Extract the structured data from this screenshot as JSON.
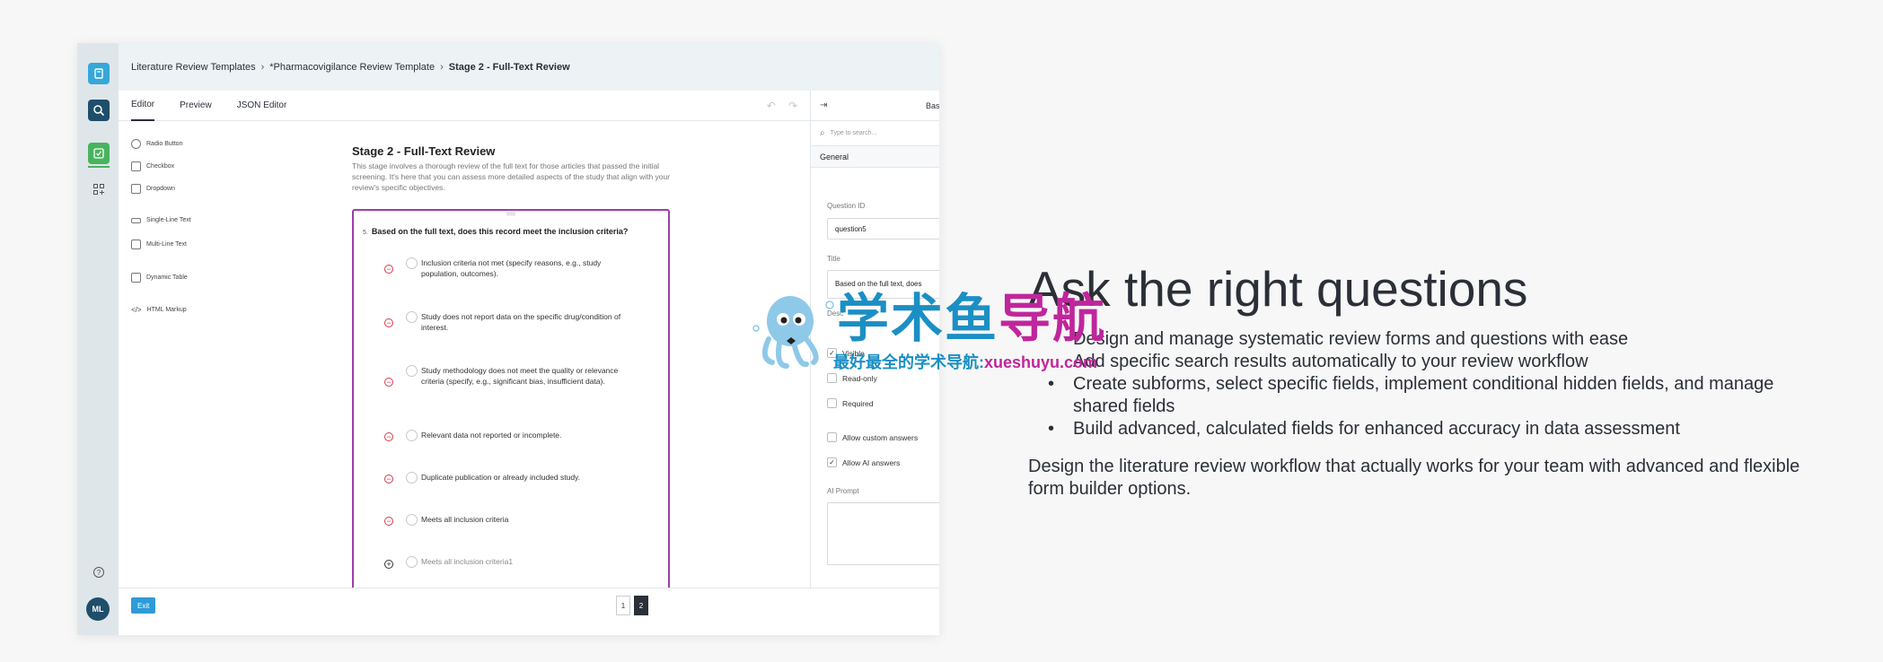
{
  "breadcrumb": [
    "Literature Review Templates",
    "*Pharmacovigilance Review Template",
    "Stage 2 - Full-Text Review"
  ],
  "tabs": [
    {
      "label": "Editor",
      "active": true
    },
    {
      "label": "Preview",
      "active": false
    },
    {
      "label": "JSON Editor",
      "active": false
    }
  ],
  "toolbox": [
    {
      "label": "Radio Button",
      "icon": "radio-icon"
    },
    {
      "label": "Checkbox",
      "icon": "checkbox-icon"
    },
    {
      "label": "Dropdown",
      "icon": "dropdown-icon"
    },
    {
      "label": "Single-Line Text",
      "icon": "single-line-icon"
    },
    {
      "label": "Multi-Line Text",
      "icon": "multi-line-icon"
    },
    {
      "label": "Dynamic Table",
      "icon": "table-icon"
    },
    {
      "label": "HTML Markup",
      "icon": "code-icon"
    }
  ],
  "page": {
    "title": "Stage 2 - Full-Text Review",
    "description": "This stage involves a thorough review of the full text for those articles that passed the initial screening. It's here that you can assess more detailed aspects of the study that align with your review's specific objectives."
  },
  "question": {
    "number": "5.",
    "title": "Based on the full text, does this record meet the inclusion criteria?",
    "choices": [
      "Inclusion criteria not met (specify reasons, e.g., study population, outcomes).",
      "Study does not report data on the specific drug/condition of interest.",
      "Study methodology does not meet the quality or relevance criteria (specify, e.g., significant bias, insufficient data).",
      "Relevant data not reported or incomplete.",
      "Duplicate publication or already included study.",
      "Meets all inclusion criteria"
    ],
    "new_choice": "Meets all inclusion criteria1"
  },
  "props": {
    "tab_label": "Bas",
    "search_placeholder": "Type to search...",
    "section": "General",
    "question_id_label": "Question ID",
    "question_id_value": "question5",
    "title_label": "Title",
    "title_value": "Based on the full text, does",
    "description_label": "Desc",
    "checks": [
      {
        "label": "Visible",
        "checked": true
      },
      {
        "label": "Read-only",
        "checked": false
      },
      {
        "label": "Required",
        "checked": false
      },
      {
        "label": "Allow custom answers",
        "checked": false
      },
      {
        "label": "Allow AI answers",
        "checked": true
      }
    ],
    "ai_prompt_label": "AI Prompt"
  },
  "bottom": {
    "exit_label": "Exit",
    "pages": [
      "1",
      "2"
    ],
    "current_page": "2"
  },
  "user": {
    "initials": "ML"
  },
  "hero": {
    "title": "Ask the right questions",
    "bullets": [
      "Design and manage systematic review forms and questions with ease",
      "Add specific search results automatically to your review workflow",
      "Create subforms, select specific fields, implement conditional hidden fields, and manage shared fields",
      "Build advanced, calculated fields for enhanced accuracy in data assessment"
    ],
    "footer": "Design the literature review workflow that actually works for your team with advanced and flexible form builder options."
  },
  "watermark": {
    "main_a": "学术鱼",
    "main_b": "导航",
    "sub_a": "最好最全的学术导航:",
    "sub_b": "xueshuyu.com"
  },
  "colors": {
    "accent": "#2f9bd6",
    "question_border": "#9b3fa8",
    "remove": "#d23b4e",
    "rail": "#dfe6ea"
  }
}
